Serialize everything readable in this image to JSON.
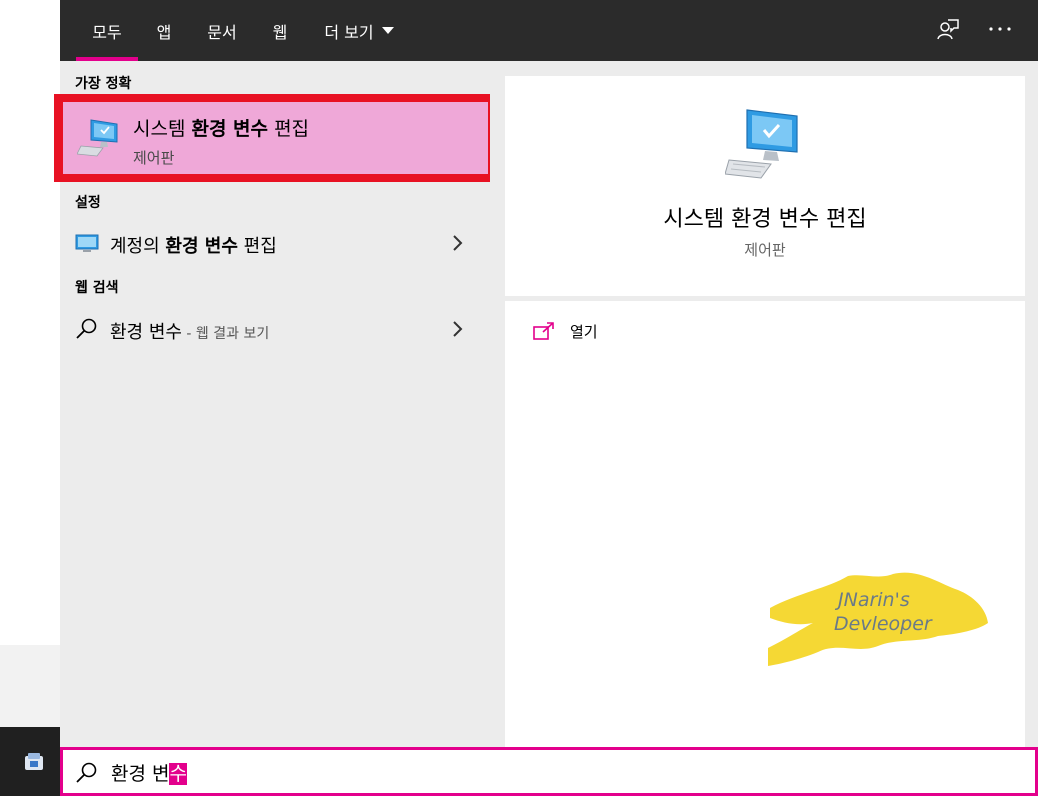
{
  "tabs": [
    {
      "label": "모두",
      "active": true
    },
    {
      "label": "앱"
    },
    {
      "label": "문서"
    },
    {
      "label": "웹"
    },
    {
      "label": "더 보기"
    }
  ],
  "topbar_icons": [
    "feedback-icon",
    "more-icon"
  ],
  "sections": {
    "best_match_header": "가장 정확",
    "settings_header": "설정",
    "web_header": "웹 검색"
  },
  "best_match": {
    "title_pre": "시스템 ",
    "title_bold": "환경 변수",
    "title_post": " 편집",
    "subtitle": "제어판"
  },
  "settings_item": {
    "pre": "계정의 ",
    "bold": "환경 변수",
    "post": " 편집"
  },
  "web_item": {
    "query": "환경 변수",
    "suffix": " - 웹 결과 보기"
  },
  "preview": {
    "title": "시스템 환경 변수 편집",
    "subtitle": "제어판",
    "open_label": "열기"
  },
  "watermark": {
    "line1": "JNarin's",
    "line2": "Devleoper"
  },
  "search": {
    "typed": "환경 변",
    "selected": "수"
  },
  "colors": {
    "accent": "#e3008c",
    "highlight_border": "#e81123",
    "selection_bg": "#efa8d8",
    "topbar": "#2b2b2b"
  }
}
